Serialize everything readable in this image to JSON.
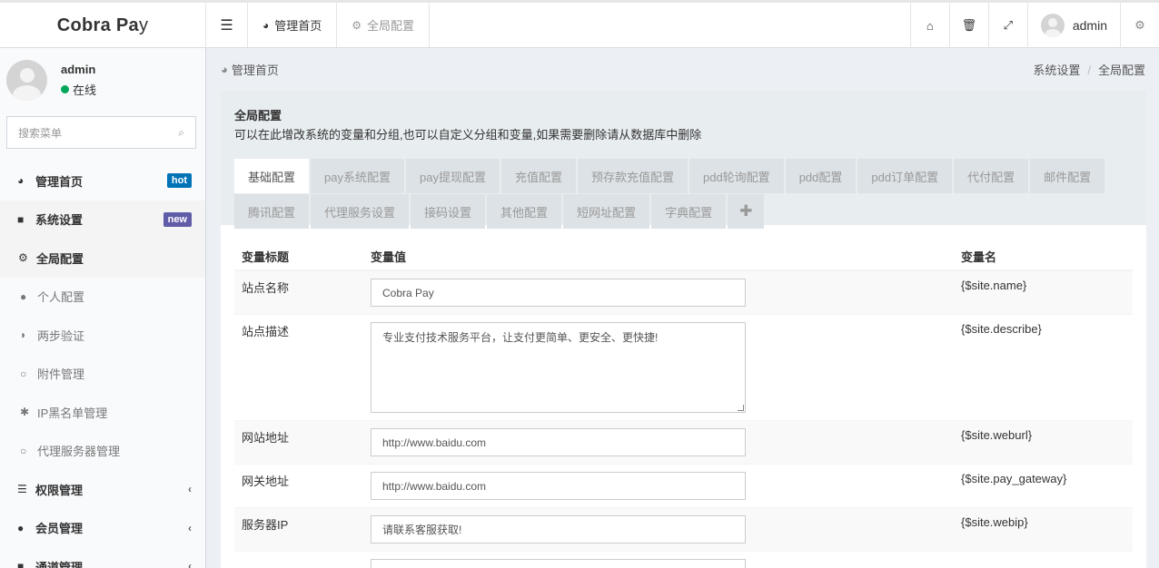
{
  "header": {
    "logo_main": "Cobra Pa",
    "logo_tail": "y",
    "tabs": [
      {
        "label": "管理首页",
        "icon": "dashboard-icon"
      },
      {
        "label": "全局配置",
        "icon": "cogs-icon"
      }
    ],
    "user": "admin"
  },
  "sidebar": {
    "user_name": "admin",
    "user_status": "在线",
    "search_placeholder": "搜索菜单",
    "items": [
      {
        "label": "管理首页",
        "badge": "hot"
      },
      {
        "label": "系统设置",
        "badge": "new"
      },
      {
        "label": "全局配置"
      },
      {
        "label": "个人配置"
      },
      {
        "label": "两步验证"
      },
      {
        "label": "附件管理"
      },
      {
        "label": "IP黑名单管理"
      },
      {
        "label": "代理服务器管理"
      },
      {
        "label": "权限管理"
      },
      {
        "label": "会员管理"
      },
      {
        "label": "通道管理"
      }
    ]
  },
  "breadcrumb": {
    "left": "管理首页",
    "right": [
      "系统设置",
      "全局配置"
    ]
  },
  "panel": {
    "title": "全局配置",
    "description": "可以在此增改系统的变量和分组,也可以自定义分组和变量,如果需要删除请从数据库中删除",
    "tabs": [
      "基础配置",
      "pay系统配置",
      "pay提现配置",
      "充值配置",
      "预存款充值配置",
      "pdd轮询配置",
      "pdd配置",
      "pdd订单配置",
      "代付配置",
      "邮件配置",
      "腾讯配置",
      "代理服务设置",
      "接码设置",
      "其他配置",
      "短网址配置",
      "字典配置"
    ],
    "plus": "✚"
  },
  "table": {
    "headers": [
      "变量标题",
      "变量值",
      "变量名"
    ],
    "rows": [
      {
        "title": "站点名称",
        "value": "Cobra Pay",
        "var": "{$site.name}"
      },
      {
        "title": "站点描述",
        "value": "专业支付技术服务平台，让支付更简单、更安全、更快捷!",
        "var": "{$site.describe}"
      },
      {
        "title": "网站地址",
        "value": "http://www.baidu.com",
        "var": "{$site.weburl}"
      },
      {
        "title": "网关地址",
        "value": "http://www.baidu.com",
        "var": "{$site.pay_gateway}"
      },
      {
        "title": "服务器IP",
        "value": "请联系客服获取!",
        "var": "{$site.webip}"
      }
    ]
  }
}
